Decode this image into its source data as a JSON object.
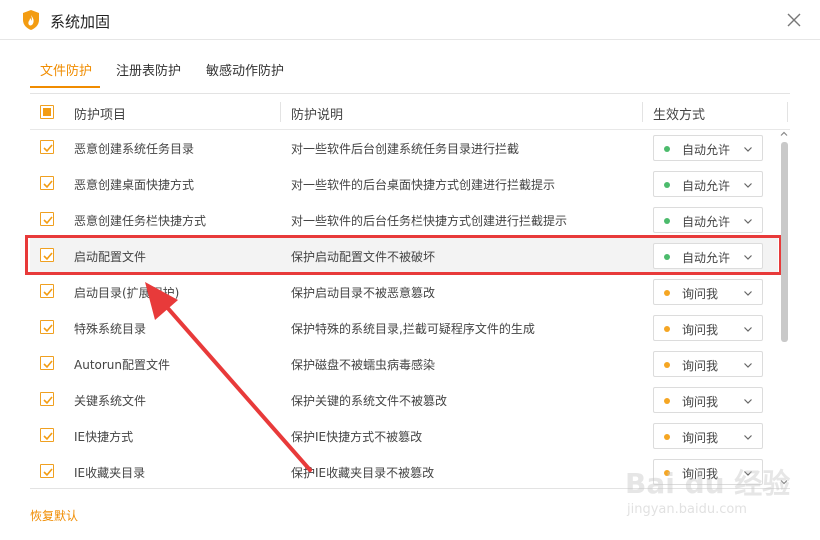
{
  "window": {
    "title": "系统加固"
  },
  "tabs": [
    {
      "label": "文件防护",
      "active": true
    },
    {
      "label": "注册表防护",
      "active": false
    },
    {
      "label": "敏感动作防护",
      "active": false
    }
  ],
  "table": {
    "headers": [
      "防护项目",
      "防护说明",
      "生效方式"
    ],
    "rows": [
      {
        "name": "恶意创建系统任务目录",
        "desc": "对一些软件后台创建系统任务目录进行拦截",
        "mode": "自动允许",
        "mode_color": "#4cbb6c"
      },
      {
        "name": "恶意创建桌面快捷方式",
        "desc": "对一些软件的后台桌面快捷方式创建进行拦截提示",
        "mode": "自动允许",
        "mode_color": "#4cbb6c"
      },
      {
        "name": "恶意创建任务栏快捷方式",
        "desc": "对一些软件的后台任务栏快捷方式创建进行拦截提示",
        "mode": "自动允许",
        "mode_color": "#4cbb6c"
      },
      {
        "name": "启动配置文件",
        "desc": "保护启动配置文件不被破坏",
        "mode": "自动允许",
        "mode_color": "#4cbb6c"
      },
      {
        "name": "启动目录(扩展保护)",
        "desc": "保护启动目录不被恶意篡改",
        "mode": "询问我",
        "mode_color": "#f5a623"
      },
      {
        "name": "特殊系统目录",
        "desc": "保护特殊的系统目录,拦截可疑程序文件的生成",
        "mode": "询问我",
        "mode_color": "#f5a623"
      },
      {
        "name": "Autorun配置文件",
        "desc": "保护磁盘不被蠕虫病毒感染",
        "mode": "询问我",
        "mode_color": "#f5a623"
      },
      {
        "name": "关键系统文件",
        "desc": "保护关键的系统文件不被篡改",
        "mode": "询问我",
        "mode_color": "#f5a623"
      },
      {
        "name": "IE快捷方式",
        "desc": "保护IE快捷方式不被篡改",
        "mode": "询问我",
        "mode_color": "#f5a623"
      },
      {
        "name": "IE收藏夹目录",
        "desc": "保护IE收藏夹目录不被篡改",
        "mode": "询问我",
        "mode_color": "#f5a623"
      }
    ]
  },
  "footer": {
    "restore_label": "恢复默认"
  },
  "watermark": {
    "main": "Bai du 经验",
    "sub": "jingyan.baidu.com"
  },
  "colors": {
    "accent": "#f08c00",
    "annotation": "#e83a3a"
  }
}
